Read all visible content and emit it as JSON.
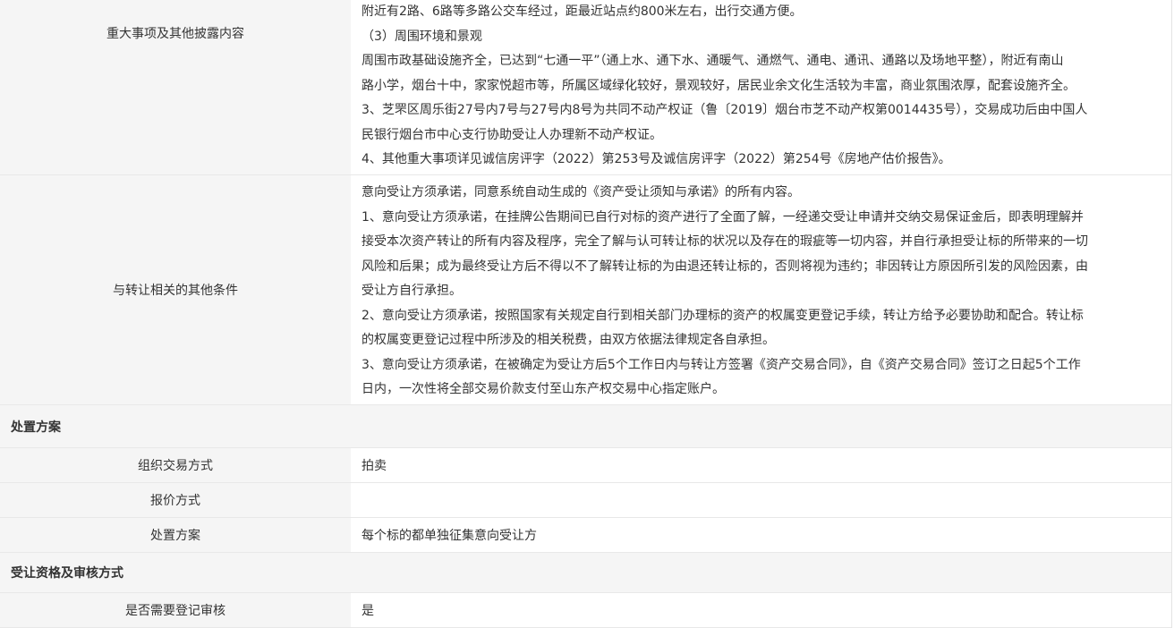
{
  "rows_top": [
    {
      "label": "重大事项及其他披露内容",
      "lines": [
        "附近有2路、6路等多路公交车经过，距最近站点约800米左右，出行交通方便。",
        "（3）周围环境和景观",
        "周围市政基础设施齐全，已达到“七通一平”（通上水、通下水、通暖气、通燃气、通电、通讯、通路以及场地平整），附近有南山",
        "路小学，烟台十中，家家悦超市等，所属区域绿化较好，景观较好，居民业余文化生活较为丰富，商业氛围浓厚，配套设施齐全。",
        "3、芝罘区周乐街27号内7号与27号内8号为共同不动产权证（鲁〔2019〕烟台市芝不动产权第0014435号），交易成功后由中国人",
        "民银行烟台市中心支行协助受让人办理新不动产权证。",
        "4、其他重大事项详见诚信房评字（2022）第253号及诚信房评字（2022）第254号《房地产估价报告》。"
      ]
    },
    {
      "label": "与转让相关的其他条件",
      "lines": [
        "意向受让方须承诺，同意系统自动生成的《资产受让须知与承诺》的所有内容。",
        "1、意向受让方须承诺，在挂牌公告期间已自行对标的资产进行了全面了解，一经递交受让申请并交纳交易保证金后，即表明理解并",
        "接受本次资产转让的所有内容及程序，完全了解与认可转让标的状况以及存在的瑕疵等一切内容，并自行承担受让标的所带来的一切",
        "风险和后果；成为最终受让方后不得以不了解转让标的为由退还转让标的，否则将视为违约；非因转让方原因所引发的风险因素，由",
        "受让方自行承担。",
        "2、意向受让方须承诺，按照国家有关规定自行到相关部门办理标的资产的权属变更登记手续，转让方给予必要协助和配合。转让标",
        "的权属变更登记过程中所涉及的相关税费，由双方依据法律规定各自承担。",
        "3、意向受让方须承诺，在被确定为受让方后5个工作日内与转让方签署《资产交易合同》，自《资产交易合同》签订之日起5个工作",
        "日内，一次性将全部交易价款支付至山东产权交易中心指定账户。"
      ]
    }
  ],
  "section_disposal": {
    "title": "处置方案",
    "rows": [
      {
        "label": "组织交易方式",
        "value": "拍卖"
      },
      {
        "label": "报价方式",
        "value": ""
      },
      {
        "label": "处置方案",
        "value": "每个标的都单独征集意向受让方"
      }
    ]
  },
  "section_qualification": {
    "title": "受让资格及审核方式",
    "rows": [
      {
        "label": "是否需要登记审核",
        "value": "是"
      }
    ]
  }
}
